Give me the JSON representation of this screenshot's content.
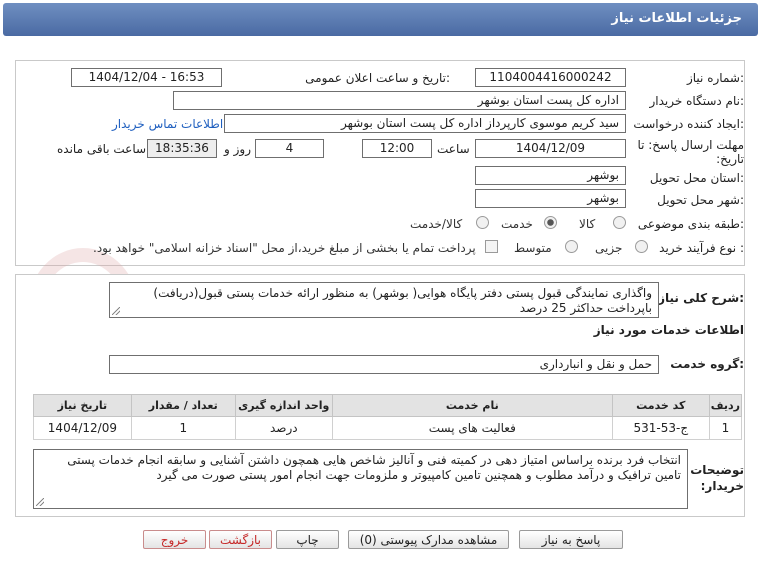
{
  "page": {
    "title": "جزئیات اطلاعات نیاز"
  },
  "watermark": {
    "text": "AriaTender.net"
  },
  "form": {
    "need_number": {
      "label": "شماره نیاز:",
      "value": "1104004416000242"
    },
    "announce_datetime": {
      "label": "تاریخ و ساعت اعلان عمومی:",
      "value": "1404/12/04 - 16:53"
    },
    "buyer_org": {
      "label": "نام دستگاه خریدار:",
      "value": "اداره کل پست استان بوشهر"
    },
    "requester": {
      "label": "ایجاد کننده درخواست:",
      "value": "سید کریم موسوی کارپرداز اداره کل پست استان بوشهر"
    },
    "contact_link": "اطلاعات تماس خریدار",
    "deadline": {
      "label": "مهلت ارسال پاسخ: تا تاریخ:",
      "date": "1404/12/09",
      "time_label": "ساعت",
      "time": "12:00",
      "days": "4",
      "days_label": "روز و",
      "remaining": "18:35:36",
      "remaining_label": "ساعت باقی مانده"
    },
    "delivery_province": {
      "label": "استان محل تحویل:",
      "value": "بوشهر"
    },
    "delivery_city": {
      "label": "شهر محل تحویل:",
      "value": "بوشهر"
    },
    "category": {
      "label": "طبقه بندی موضوعی:",
      "options": [
        "کالا",
        "خدمت",
        "کالا/خدمت"
      ],
      "selected": "خدمت"
    },
    "process_type": {
      "label": "نوع فرآیند خرید :",
      "options": [
        "جزیی",
        "متوسط"
      ],
      "payment_note": "پرداخت تمام یا بخشی از مبلغ خرید،از محل \"اسناد خزانه اسلامی\" خواهد بود."
    }
  },
  "summary": {
    "label": "شرح کلی نیاز:",
    "text": "واگذاری نمایندگی قبول پستی دفتر پایگاه هوایی( بوشهر) به منظور ارائه خدمات پستی قبول(دریافت) باپرداخت حداکثر 25 درصد"
  },
  "services": {
    "section_title": "اطلاعات خدمات مورد نیاز",
    "group_label": "گروه خدمت:",
    "group_value": "حمل و نقل و انبارداری",
    "columns": [
      "ردیف",
      "کد خدمت",
      "نام خدمت",
      "واحد اندازه گیری",
      "تعداد / مقدار",
      "تاریخ نیاز"
    ],
    "rows": [
      {
        "row": "1",
        "code": "ج-53-531",
        "name": "فعالیت های پست",
        "unit": "درصد",
        "qty": "1",
        "date": "1404/12/09"
      }
    ]
  },
  "buyer_notes": {
    "label": "توضیحات خریدار:",
    "text": "انتخاب فرد برنده براساس امتیاز دهی در کمیته فنی و  آنالیز شاخص هایی همچون داشتن آشنایی و سابقه انجام خدمات پستی تامین ترافیک و درآمد مطلوب و همچنین تامین کامپیوتر و ملزومات جهت انجام امور پستی  صورت می گیرد"
  },
  "buttons": {
    "reply": "پاسخ به نیاز",
    "view_docs": "مشاهده مدارک پیوستی (0)",
    "print": "چاپ",
    "back": "بازگشت",
    "exit": "خروج"
  }
}
